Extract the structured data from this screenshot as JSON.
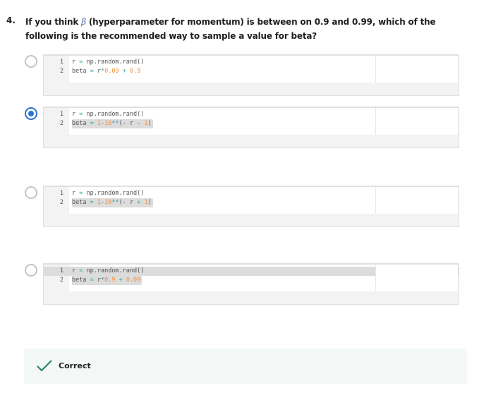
{
  "question": {
    "number": "4.",
    "text_before": "If you think ",
    "symbol": "β",
    "text_after": " (hyperparameter for momentum) is between on 0.9 and 0.99, which of the following is the recommended way to sample a value for beta?"
  },
  "colors": {
    "default": "#555555",
    "operator": "#3aa0a8",
    "number": "#f0903c",
    "selected": "#2a73cc",
    "correct": "#1f8354"
  },
  "options": [
    {
      "selected": false,
      "lines": [
        {
          "n": "1",
          "tokens": [
            {
              "t": "r ",
              "c": "default"
            },
            {
              "t": "=",
              "c": "operator"
            },
            {
              "t": " np.random.rand()",
              "c": "default"
            }
          ]
        },
        {
          "n": "2",
          "tokens": [
            {
              "t": "beta ",
              "c": "default"
            },
            {
              "t": "=",
              "c": "operator"
            },
            {
              "t": " r",
              "c": "default"
            },
            {
              "t": "*",
              "c": "operator"
            },
            {
              "t": "0.09",
              "c": "number"
            },
            {
              "t": " + ",
              "c": "operator"
            },
            {
              "t": "0.9",
              "c": "number"
            }
          ]
        }
      ]
    },
    {
      "selected": true,
      "lines": [
        {
          "n": "1",
          "tokens": [
            {
              "t": "r ",
              "c": "default"
            },
            {
              "t": "=",
              "c": "operator"
            },
            {
              "t": " np.random.rand()",
              "c": "default"
            }
          ]
        },
        {
          "n": "2",
          "tokens": [
            {
              "t": "beta ",
              "c": "default"
            },
            {
              "t": "=",
              "c": "operator"
            },
            {
              "t": " ",
              "c": "default"
            },
            {
              "t": "1",
              "c": "number"
            },
            {
              "t": "-",
              "c": "operator"
            },
            {
              "t": "10",
              "c": "number"
            },
            {
              "t": "**",
              "c": "operator"
            },
            {
              "t": "(- r - ",
              "c": "default"
            },
            {
              "t": "1",
              "c": "number"
            },
            {
              "t": ")",
              "c": "default"
            }
          ]
        }
      ]
    },
    {
      "selected": false,
      "lines": [
        {
          "n": "1",
          "tokens": [
            {
              "t": "r ",
              "c": "default"
            },
            {
              "t": "=",
              "c": "operator"
            },
            {
              "t": " np.random.rand()",
              "c": "default"
            }
          ]
        },
        {
          "n": "2",
          "tokens": [
            {
              "t": "beta ",
              "c": "default"
            },
            {
              "t": "=",
              "c": "operator"
            },
            {
              "t": " ",
              "c": "default"
            },
            {
              "t": "1",
              "c": "number"
            },
            {
              "t": "-",
              "c": "operator"
            },
            {
              "t": "10",
              "c": "number"
            },
            {
              "t": "**",
              "c": "operator"
            },
            {
              "t": "(- r ",
              "c": "default"
            },
            {
              "t": "+",
              "c": "operator"
            },
            {
              "t": " ",
              "c": "default"
            },
            {
              "t": "1",
              "c": "number"
            },
            {
              "t": ")",
              "c": "default"
            }
          ]
        }
      ]
    },
    {
      "selected": false,
      "lines": [
        {
          "n": "1",
          "tokens": [
            {
              "t": "r ",
              "c": "default"
            },
            {
              "t": "=",
              "c": "operator"
            },
            {
              "t": " np.random.rand()",
              "c": "default"
            }
          ]
        },
        {
          "n": "2",
          "tokens": [
            {
              "t": "beta ",
              "c": "default"
            },
            {
              "t": "=",
              "c": "operator"
            },
            {
              "t": " r",
              "c": "default"
            },
            {
              "t": "*",
              "c": "operator"
            },
            {
              "t": "0.9",
              "c": "number"
            },
            {
              "t": " + ",
              "c": "operator"
            },
            {
              "t": "0.09",
              "c": "number"
            }
          ]
        }
      ]
    }
  ],
  "feedback": {
    "label": "Correct",
    "icon": "checkmark-icon"
  }
}
